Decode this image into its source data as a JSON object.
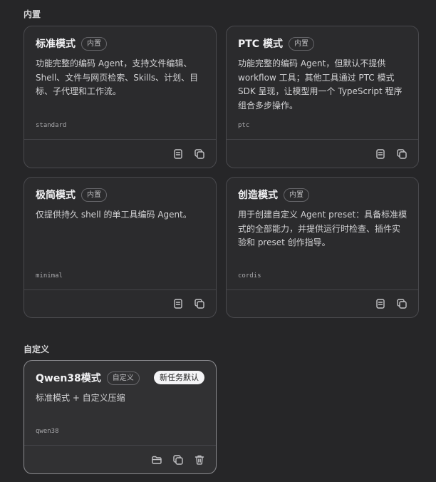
{
  "sections": {
    "builtin": "内置",
    "custom": "自定义"
  },
  "cards": [
    {
      "title": "标准模式",
      "badge": "内置",
      "desc": "功能完整的编码 Agent，支持文件编辑、Shell、文件与网页检索、Skills、计划、目标、子代理和工作流。",
      "id": "standard"
    },
    {
      "title": "PTC 模式",
      "badge": "内置",
      "desc": "功能完整的编码 Agent，但默认不提供 workflow 工具；其他工具通过 PTC 模式 SDK 呈现，让模型用一个 TypeScript 程序组合多步操作。",
      "id": "ptc"
    },
    {
      "title": "极简模式",
      "badge": "内置",
      "desc": "仅提供持久 shell 的单工具编码 Agent。",
      "id": "minimal"
    },
    {
      "title": "创造模式",
      "badge": "内置",
      "desc": "用于创建自定义 Agent preset：具备标准模式的全部能力，并提供运行时检查、插件实验和 preset 创作指导。",
      "id": "cordis"
    }
  ],
  "custom_card": {
    "title": "Qwen38模式",
    "badge": "自定义",
    "default_label": "新任务默认",
    "desc": "标准模式 + 自定义压缩",
    "id": "qwen38"
  },
  "icons": {
    "view": "document-icon",
    "copy": "copy-icon",
    "folder": "folder-icon",
    "delete": "trash-icon"
  }
}
